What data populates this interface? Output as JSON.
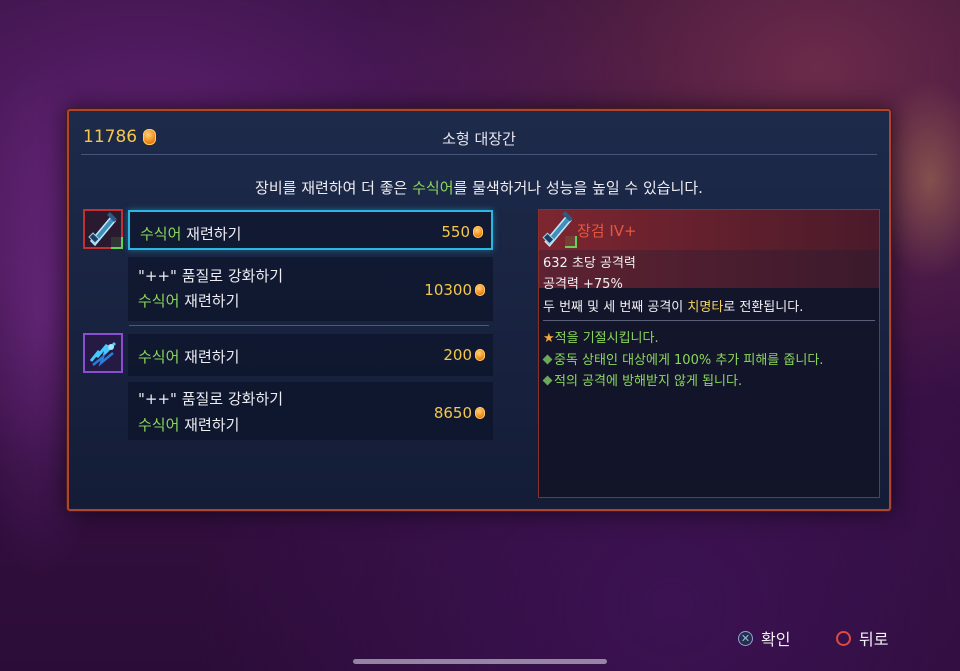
{
  "header": {
    "gold_amount": "11786",
    "title": "소형 대장간"
  },
  "subtitle": {
    "part1": "장비를 재련하여 더 좋은 ",
    "highlight": "수식어",
    "part2": "를 물색하거나 성능을 높일 수 있습니다."
  },
  "items": [
    {
      "icon": "broadsword-icon",
      "options": [
        {
          "line1_green": "수식어",
          "line1_rest": " 재련하기",
          "price": "550",
          "selected": true
        },
        {
          "line1": "\"++\" 품질로 강화하기",
          "line2_green": "수식어",
          "line2_rest": " 재련하기",
          "price": "10300"
        }
      ]
    },
    {
      "icon": "lightning-fist-icon",
      "options": [
        {
          "line1_green": "수식어",
          "line1_rest": " 재련하기",
          "price": "200"
        },
        {
          "line1": "\"++\" 품질로 강화하기",
          "line2_green": "수식어",
          "line2_rest": " 재련하기",
          "price": "8650"
        }
      ]
    }
  ],
  "detail": {
    "name": "장검 IV+",
    "dps": "632 초당 공격력",
    "attack": "공격력 +75%",
    "effect_part1": "두 번째 및 세 번째 공격이 ",
    "effect_highlight": "치명타",
    "effect_part2": "로 전환됩니다.",
    "perks": [
      {
        "text": "적을 기절시킵니다.",
        "color": "#f2c24a"
      },
      {
        "text_green": "중독",
        "text_rest": " 상태인 대상에게 100% 추가 피해를 줍니다.",
        "color": "#8bd65a"
      },
      {
        "text": "적의 공격에 방해받지 않게 됩니다.",
        "color": "#8bd65a"
      }
    ]
  },
  "footer": {
    "confirm": "확인",
    "back": "뒤로"
  },
  "colors": {
    "accent_gold": "#f4c84a",
    "modifier_green": "#8bd65a",
    "crit_yellow": "#f6d35a",
    "item_name_red": "#e8553e",
    "selection_cyan": "#2ab8e0"
  }
}
